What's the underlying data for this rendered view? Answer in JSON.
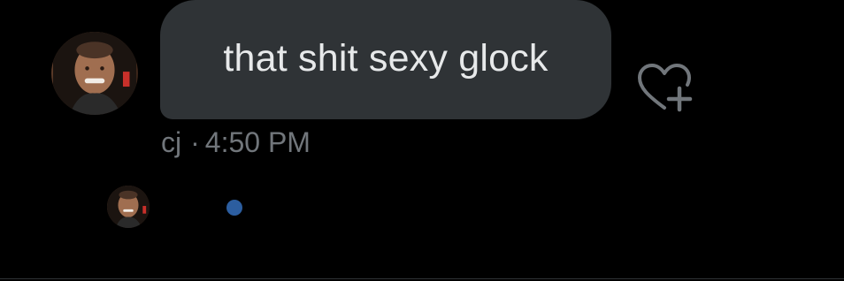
{
  "message": {
    "text": "that shit sexy glock",
    "sender": "cj",
    "separator": "·",
    "time": "4:50 PM"
  },
  "icons": {
    "react": "heart-plus-icon",
    "avatar": "user-avatar",
    "seen": "seen-indicator-dot"
  },
  "colors": {
    "background": "#000000",
    "bubble": "#2f3336",
    "bubble_text": "#e7e9ea",
    "meta_text": "#71767b",
    "icon": "#71767b",
    "seen_dot": "#2c5ea0"
  }
}
